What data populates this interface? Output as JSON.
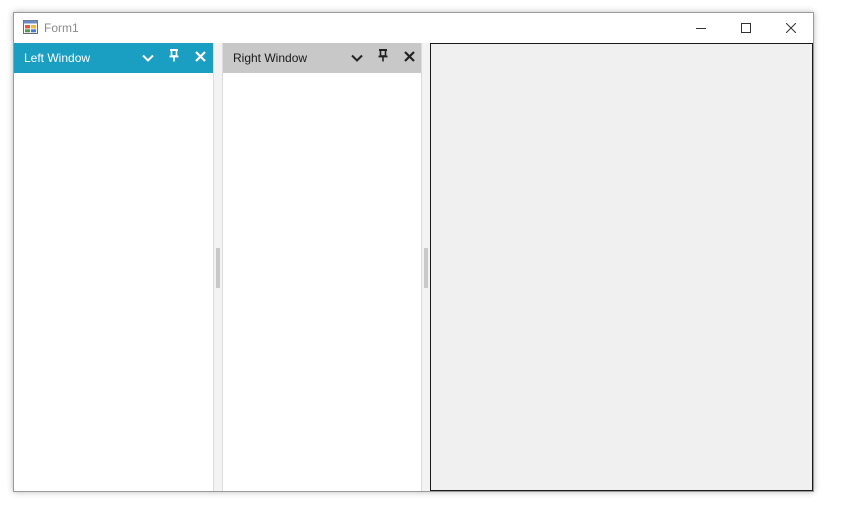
{
  "window": {
    "title": "Form1",
    "icon": "windows-form-icon",
    "caption_buttons": {
      "minimize": "minimize-icon",
      "maximize": "maximize-icon",
      "close": "close-icon"
    }
  },
  "panes": {
    "left": {
      "title": "Left Window",
      "state": "active",
      "header_color": "#1a9ec2",
      "buttons": [
        "chevron-down-icon",
        "pin-icon",
        "close-icon"
      ]
    },
    "right": {
      "title": "Right Window",
      "state": "inactive",
      "header_color": "#c8c8c8",
      "buttons": [
        "chevron-down-icon",
        "pin-icon",
        "close-icon"
      ]
    }
  },
  "document_area": {
    "background": "#f0f0f0",
    "border_color": "#1a1a1a"
  }
}
